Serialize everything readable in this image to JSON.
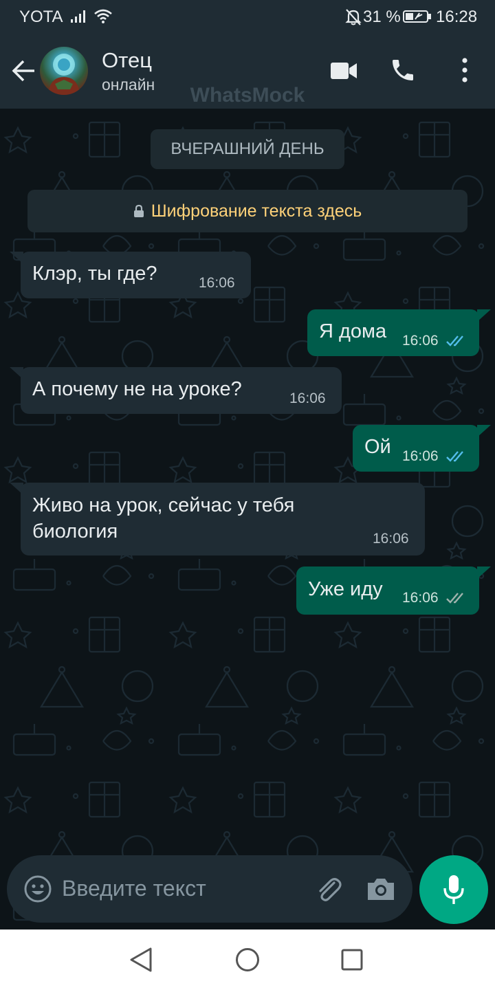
{
  "status_bar": {
    "carrier": "YOTA",
    "battery": "31 %",
    "time": "16:28"
  },
  "header": {
    "contact_name": "Отец",
    "contact_status": "онлайн",
    "watermark": "WhatsMock"
  },
  "chat": {
    "date_label": "ВЧЕРАШНИЙ ДЕНЬ",
    "encryption_notice": "Шифрование текста здесь",
    "messages": [
      {
        "direction": "incoming",
        "text": "Клэр, ты где?",
        "time": "16:06"
      },
      {
        "direction": "outgoing",
        "text": "Я дома",
        "time": "16:06",
        "status": "read"
      },
      {
        "direction": "incoming",
        "text": "А почему не на уроке?",
        "time": "16:06"
      },
      {
        "direction": "outgoing",
        "text": "Ой",
        "time": "16:06",
        "status": "read"
      },
      {
        "direction": "incoming",
        "text_lines": [
          "Живо на урок, сейчас у тебя",
          "биология"
        ],
        "time": "16:06"
      },
      {
        "direction": "outgoing",
        "text": "Уже иду",
        "time": "16:06",
        "status": "delivered"
      }
    ]
  },
  "input": {
    "placeholder": "Введите текст"
  },
  "colors": {
    "header_bg": "#1f2c34",
    "chat_bg": "#0d1418",
    "incoming_bubble": "#1f2c34",
    "outgoing_bubble": "#005c4b",
    "accent": "#00a884",
    "read_tick": "#53bdeb",
    "encryption_text": "#ffd279"
  },
  "icons": [
    "signal-icon",
    "wifi-icon",
    "mute-icon",
    "battery-icon",
    "back-icon",
    "avatar",
    "video-call-icon",
    "voice-call-icon",
    "menu-icon",
    "lock-icon",
    "emoji-icon",
    "attach-icon",
    "camera-icon",
    "mic-icon",
    "nav-back-icon",
    "nav-home-icon",
    "nav-recent-icon"
  ]
}
